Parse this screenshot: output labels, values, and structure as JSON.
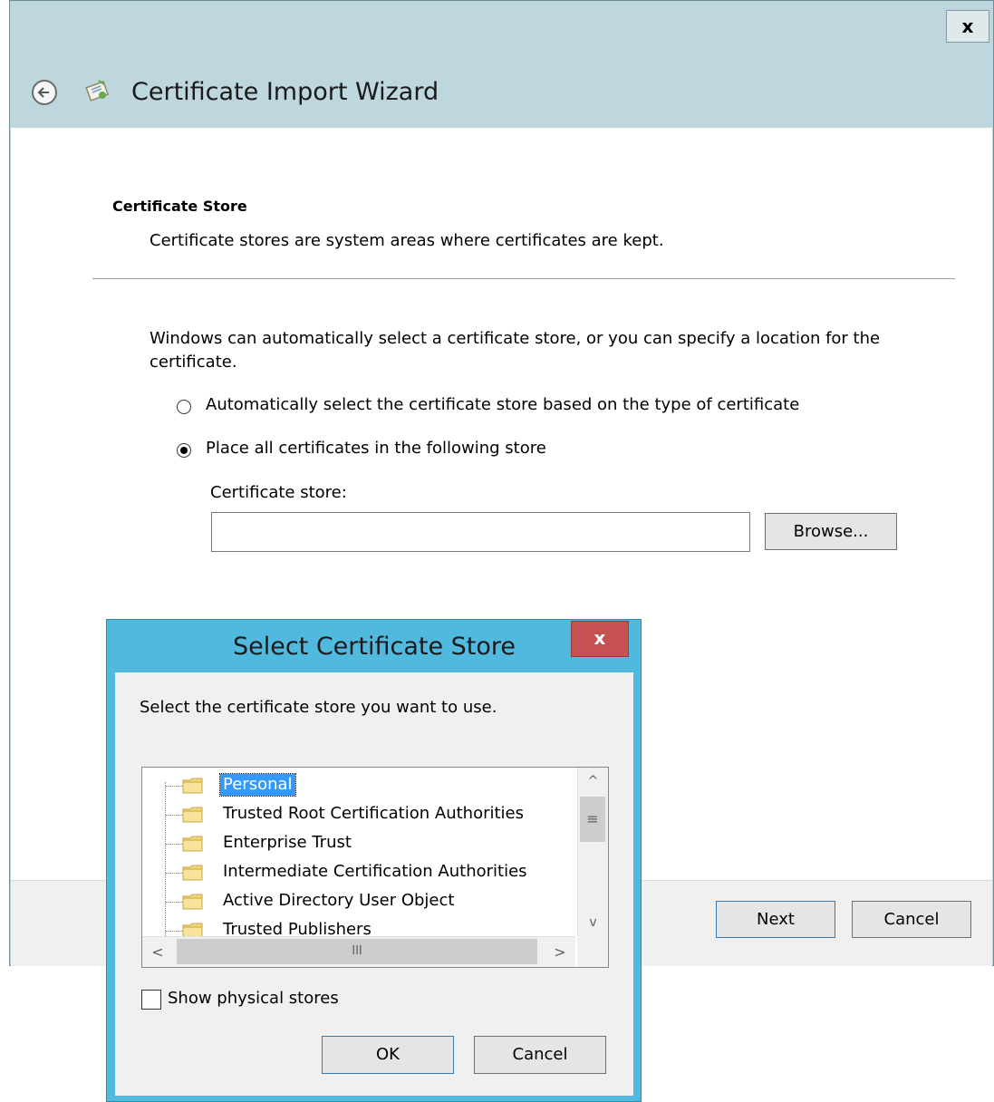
{
  "wizard": {
    "close_glyph": "x",
    "title": "Certificate Import Wizard",
    "back_icon": "back-arrow-icon",
    "title_icon": "certificate-icon",
    "heading": "Certificate Store",
    "description": "Certificate stores are system areas where certificates are kept.",
    "intro": "Windows can automatically select a certificate store, or you can specify a location for the certificate.",
    "options": [
      {
        "label": "Automatically select the certificate store based on the type of certificate",
        "selected": false
      },
      {
        "label": "Place all certificates in the following store",
        "selected": true
      }
    ],
    "store_label": "Certificate store:",
    "store_value": "",
    "browse_label": "Browse...",
    "next_label": "Next",
    "cancel_label": "Cancel"
  },
  "dialog": {
    "title": "Select Certificate Store",
    "close_glyph": "x",
    "prompt": "Select the certificate store you want to use.",
    "stores": [
      {
        "label": "Personal",
        "selected": true
      },
      {
        "label": "Trusted Root Certification Authorities",
        "selected": false
      },
      {
        "label": "Enterprise Trust",
        "selected": false
      },
      {
        "label": "Intermediate Certification Authorities",
        "selected": false
      },
      {
        "label": "Active Directory User Object",
        "selected": false
      },
      {
        "label": "Trusted Publishers",
        "selected": false
      }
    ],
    "scroll": {
      "up": "^",
      "down": "v",
      "left": "<",
      "right": ">",
      "thumb_grip": "≡",
      "h_thumb_grip": "III"
    },
    "show_physical_label": "Show physical stores",
    "show_physical_checked": false,
    "ok_label": "OK",
    "cancel_label": "Cancel"
  },
  "colors": {
    "wizard_frame": "#bed6de",
    "dialog_frame": "#51b9de",
    "close_red": "#c75050",
    "selection": "#3399ff"
  }
}
